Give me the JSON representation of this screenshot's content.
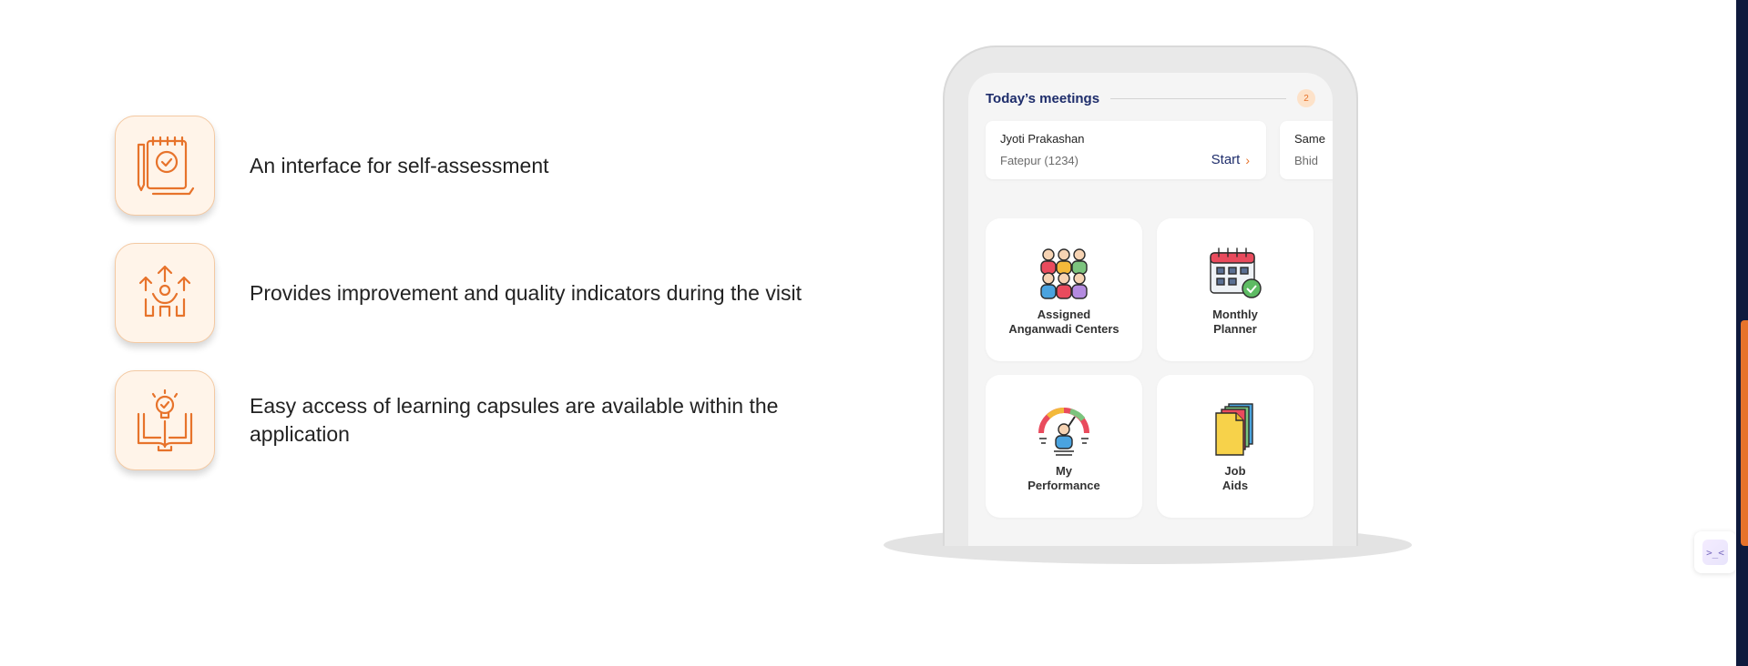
{
  "features": [
    {
      "text": "An interface for self-assessment",
      "icon": "checklist-notepad-icon"
    },
    {
      "text": "Provides improvement and quality indicators during the visit",
      "icon": "growth-arrows-person-icon"
    },
    {
      "text": "Easy access of learning capsules are available within the application",
      "icon": "book-lightbulb-icon"
    }
  ],
  "phone": {
    "meetings_title": "Today’s meetings",
    "meetings_count": "2",
    "meetings": [
      {
        "name": "Jyoti Prakashan",
        "location": "Fatepur (1234)",
        "action": "Start"
      },
      {
        "name": "Same",
        "location": "Bhid"
      }
    ],
    "tiles": [
      {
        "label": "Assigned\nAnganwadi Centers",
        "icon": "people-group-icon"
      },
      {
        "label": "Monthly\nPlanner",
        "icon": "calendar-check-icon"
      },
      {
        "label": "My\nPerformance",
        "icon": "performance-gauge-icon"
      },
      {
        "label": "Job\nAids",
        "icon": "documents-stack-icon"
      }
    ]
  },
  "colors": {
    "accent": "#e7732b",
    "navy": "#1e2d6b",
    "dark_bar": "#0f1a3d"
  }
}
